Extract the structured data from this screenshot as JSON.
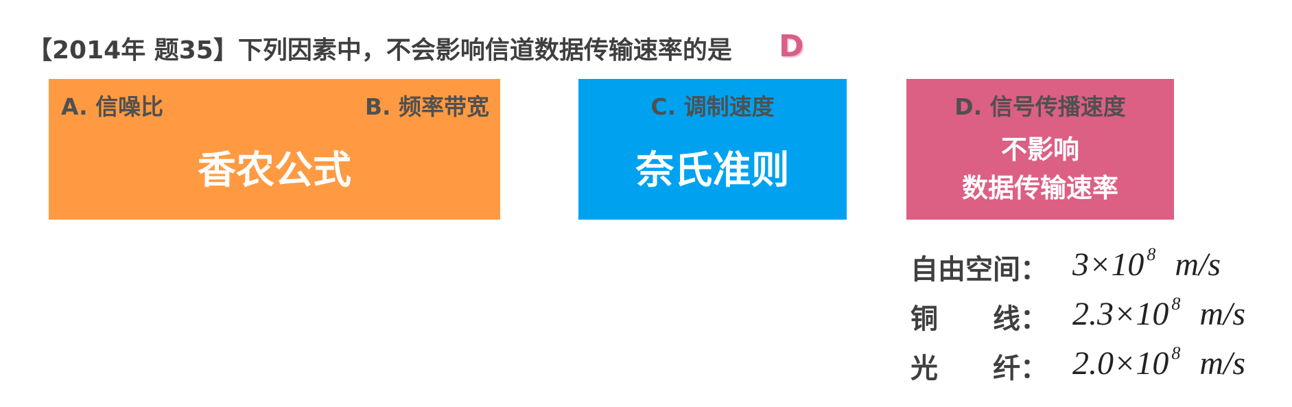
{
  "question": {
    "text": "【2014年 题35】下列因素中，不会影响信道数据传输速率的是",
    "answer": "D"
  },
  "cards": {
    "orange": {
      "option_a": "A. 信噪比",
      "option_b": "B. 频率带宽",
      "formula": "香农公式"
    },
    "blue": {
      "option_c": "C. 调制速度",
      "formula": "奈氏准则"
    },
    "pink": {
      "option_d": "D. 信号传播速度",
      "line1": "不影响",
      "line2": "数据传输速率"
    }
  },
  "speeds": [
    {
      "label": "自由空间：",
      "mantissa": "3×10",
      "exponent": "8",
      "unit": "m/s"
    },
    {
      "label": "铜　　线：",
      "mantissa": "2.3×10",
      "exponent": "8",
      "unit": "m/s"
    },
    {
      "label": "光　　纤：",
      "mantissa": "2.0×10",
      "exponent": "8",
      "unit": "m/s"
    }
  ],
  "colors": {
    "orange_card": "#ff9a42",
    "blue_card": "#00a2f0",
    "pink_card": "#dc5f84",
    "answer_accent": "#d95f86"
  }
}
